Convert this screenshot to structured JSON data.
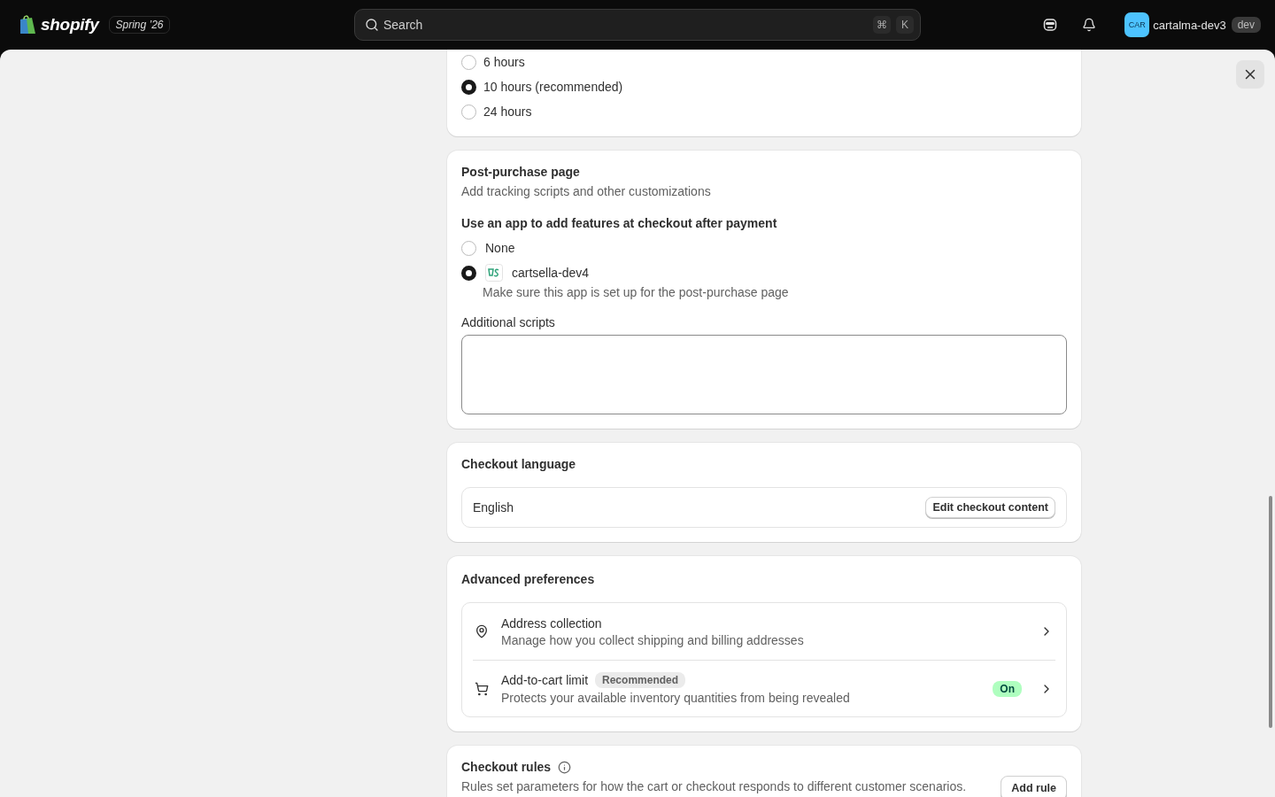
{
  "topbar": {
    "brand": "shopify",
    "edition": "Spring ’26",
    "search": {
      "placeholder": "Search"
    },
    "shortcut": [
      "⌘",
      "K"
    ],
    "store": {
      "avatar": "CAR",
      "name": "cartalma-dev3",
      "badge": "dev"
    }
  },
  "delivery_options": [
    {
      "label": "6 hours",
      "selected": false
    },
    {
      "label": "10 hours (recommended)",
      "selected": true
    },
    {
      "label": "24 hours",
      "selected": false
    }
  ],
  "post_purchase": {
    "title": "Post-purchase page",
    "subtitle": "Add tracking scripts and other customizations",
    "question": "Use an app to add features at checkout after payment",
    "options": [
      {
        "kind": "none",
        "label": "None",
        "selected": false
      },
      {
        "kind": "app",
        "label": "cartsella-dev4",
        "selected": true,
        "note": "Make sure this app is set up for the post-purchase page"
      }
    ],
    "scripts_label": "Additional scripts"
  },
  "checkout_language": {
    "title": "Checkout language",
    "value": "English",
    "button": "Edit checkout content"
  },
  "advanced": {
    "title": "Advanced preferences",
    "items": [
      {
        "kind": "address",
        "title": "Address collection",
        "description": "Manage how you collect shipping and billing addresses"
      },
      {
        "kind": "cart",
        "title": "Add-to-cart limit",
        "badge": "Recommended",
        "description": "Protects your available inventory quantities from being revealed",
        "status": "On"
      }
    ]
  },
  "checkout_rules": {
    "title": "Checkout rules",
    "description": "Rules set parameters for how the cart or checkout responds to different customer scenarios.",
    "button": "Add rule"
  }
}
